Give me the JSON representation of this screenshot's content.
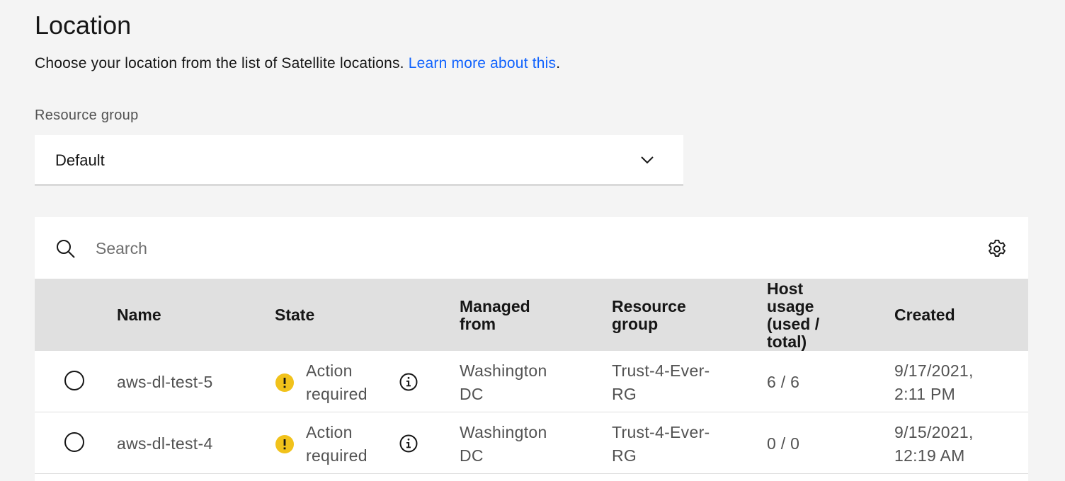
{
  "header": {
    "title": "Location",
    "description": "Choose your location from the list of Satellite locations.",
    "learn_more_link": "Learn more about this",
    "description_end": "."
  },
  "resource_group": {
    "label": "Resource group",
    "selected": "Default"
  },
  "search": {
    "placeholder": "Search"
  },
  "table": {
    "columns": {
      "name": "Name",
      "state": "State",
      "managed_from": "Managed from",
      "resource_group": "Resource group",
      "host_usage": "Host usage (used / total)",
      "created": "Created"
    },
    "rows": [
      {
        "name": "aws-dl-test-5",
        "state": "Action required",
        "managed_from": "Washington DC",
        "resource_group": "Trust-4-Ever-RG",
        "host_usage": "6 / 6",
        "created": "9/17/2021, 2:11 PM"
      },
      {
        "name": "aws-dl-test-4",
        "state": "Action required",
        "managed_from": "Washington DC",
        "resource_group": "Trust-4-Ever-RG",
        "host_usage": "0 / 0",
        "created": "9/15/2021, 12:19 AM"
      }
    ]
  },
  "colors": {
    "link": "#0f62fe",
    "warning": "#f1c21b",
    "header_bg": "#e0e0e0",
    "page_bg": "#f4f4f4"
  }
}
